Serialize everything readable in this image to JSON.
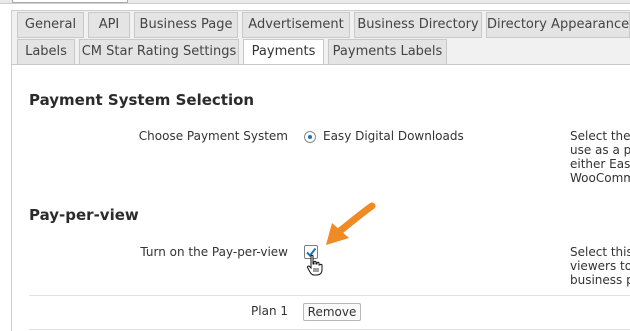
{
  "tabs_row1": [
    "General",
    "API",
    "Business Page",
    "Advertisement",
    "Business Directory",
    "Directory Appearance"
  ],
  "tabs_row2": [
    "Labels",
    "CM Star Rating Settings",
    "Payments",
    "Payments Labels"
  ],
  "active_tab": "Payments",
  "sections": {
    "payment_system": {
      "title": "Payment System Selection",
      "label": "Choose Payment System",
      "selected_option": "Easy Digital Downloads",
      "help_lines": [
        "Select the",
        "use as a pa",
        "either Easy",
        "WooComm"
      ]
    },
    "pay_per_view": {
      "title": "Pay-per-view",
      "label": "Turn on the Pay-per-view",
      "checked": true,
      "help_lines": [
        "Select this",
        "viewers to",
        "business p"
      ]
    },
    "plans": {
      "label": "Plan 1",
      "remove_label": "Remove"
    }
  },
  "colors": {
    "accent": "#2271b1",
    "arrow": "#f08a24"
  }
}
